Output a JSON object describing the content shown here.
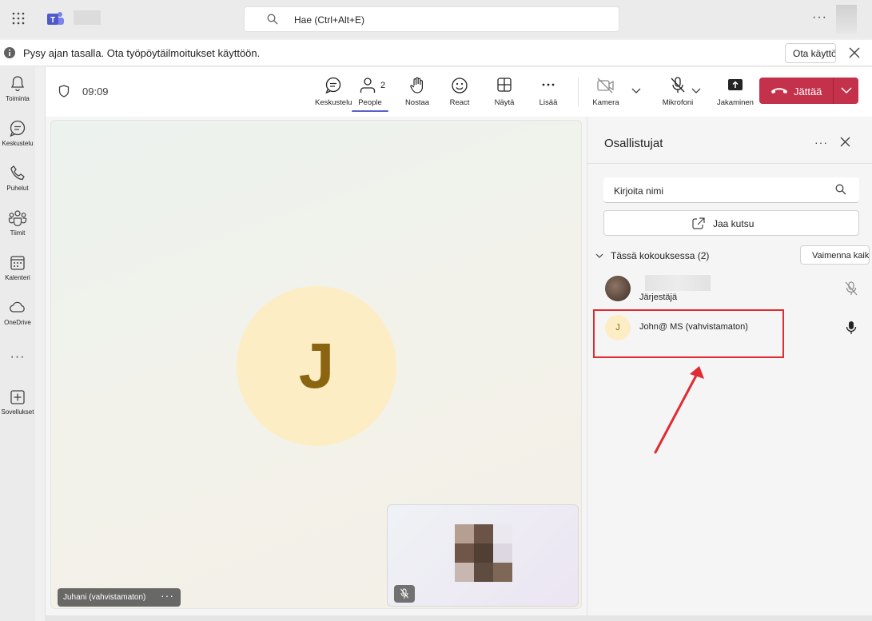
{
  "titlebar": {
    "search_placeholder": "Hae (Ctrl+Alt+E)",
    "icons": [
      "waffle-icon",
      "teams-logo",
      "search-icon",
      "more-icon"
    ]
  },
  "banner": {
    "message": "Pysy ajan tasalla. Ota työpöytäilmoitukset käyttöön.",
    "button": "Ota käyttöön"
  },
  "rail": {
    "items": [
      {
        "label": "Toiminta",
        "icon": "bell-icon"
      },
      {
        "label": "Keskustelu",
        "icon": "chat-icon"
      },
      {
        "label": "Puhelut",
        "icon": "phone-icon"
      },
      {
        "label": "Tiimit",
        "icon": "teams-icon"
      },
      {
        "label": "Kalenteri",
        "icon": "calendar-icon"
      },
      {
        "label": "OneDrive",
        "icon": "cloud-icon"
      },
      {
        "label": "",
        "icon": "more-icon"
      },
      {
        "label": "Sovellukset",
        "icon": "add-apps-icon"
      }
    ]
  },
  "toolbar": {
    "timer": "09:09",
    "chat": "Keskustelu",
    "people": "People",
    "people_count": "2",
    "raise": "Nostaa",
    "react": "React",
    "view": "Näytä",
    "more": "Lisää",
    "camera": "Kamera",
    "mic": "Mikrofoni",
    "share": "Jakaminen",
    "leave": "Jättää",
    "colors": {
      "leave": "#c4314b",
      "active_underline": "#5b5fc7"
    }
  },
  "stage": {
    "avatar_initial": "J",
    "name_tag": "Juhani (vahvistamaton)",
    "avatar_color": "#fdedc5"
  },
  "panel": {
    "title": "Osallistujat",
    "search_placeholder": "Kirjoita nimi",
    "invite": "Jaa kutsu",
    "section": "Tässä kokouksessa (2)",
    "mute_all": "Vaimenna kaikki",
    "participants": [
      {
        "name": "",
        "role": "Järjestäjä",
        "mic": "muted"
      },
      {
        "name": "John@ MS (vahvistamaton)",
        "initial": "J",
        "mic": "on"
      }
    ]
  }
}
